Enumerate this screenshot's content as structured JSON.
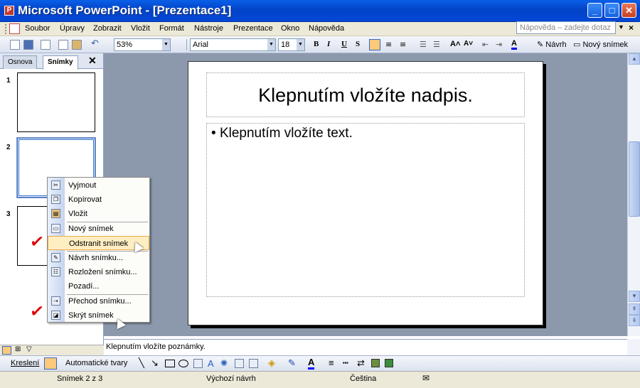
{
  "window": {
    "title": "Microsoft PowerPoint - [Prezentace1]"
  },
  "menubar": {
    "items": [
      "Soubor",
      "Úpravy",
      "Zobrazit",
      "Vložit",
      "Formát",
      "Nástroje",
      "Prezentace",
      "Okno",
      "Nápověda"
    ],
    "help_placeholder": "Nápověda – zadejte dotaz"
  },
  "toolbar": {
    "zoom": "53%",
    "font": "Arial",
    "font_size": "18",
    "design_label": "Návrh",
    "new_slide_label": "Nový snímek"
  },
  "slides_pane": {
    "tabs": [
      "Osnova",
      "Snímky"
    ],
    "slide_numbers": [
      "1",
      "2",
      "3"
    ]
  },
  "slide": {
    "title_placeholder": "Klepnutím vložíte nadpis.",
    "body_placeholder": "Klepnutím vložíte text."
  },
  "context_menu": {
    "items": [
      "Vyjmout",
      "Kopírovat",
      "Vložit",
      "Nový snímek",
      "Odstranit snímek",
      "Návrh snímku...",
      "Rozložení snímku...",
      "Pozadí...",
      "Přechod snímku...",
      "Skrýt snímek"
    ]
  },
  "notes": {
    "placeholder": "Klepnutím vložíte poznámky."
  },
  "drawing": {
    "draw_label": "Kreslení",
    "autoshapes_label": "Automatické tvary"
  },
  "status": {
    "slide_count": "Snímek 2 z 3",
    "design": "Výchozí návrh",
    "language": "Čeština"
  }
}
